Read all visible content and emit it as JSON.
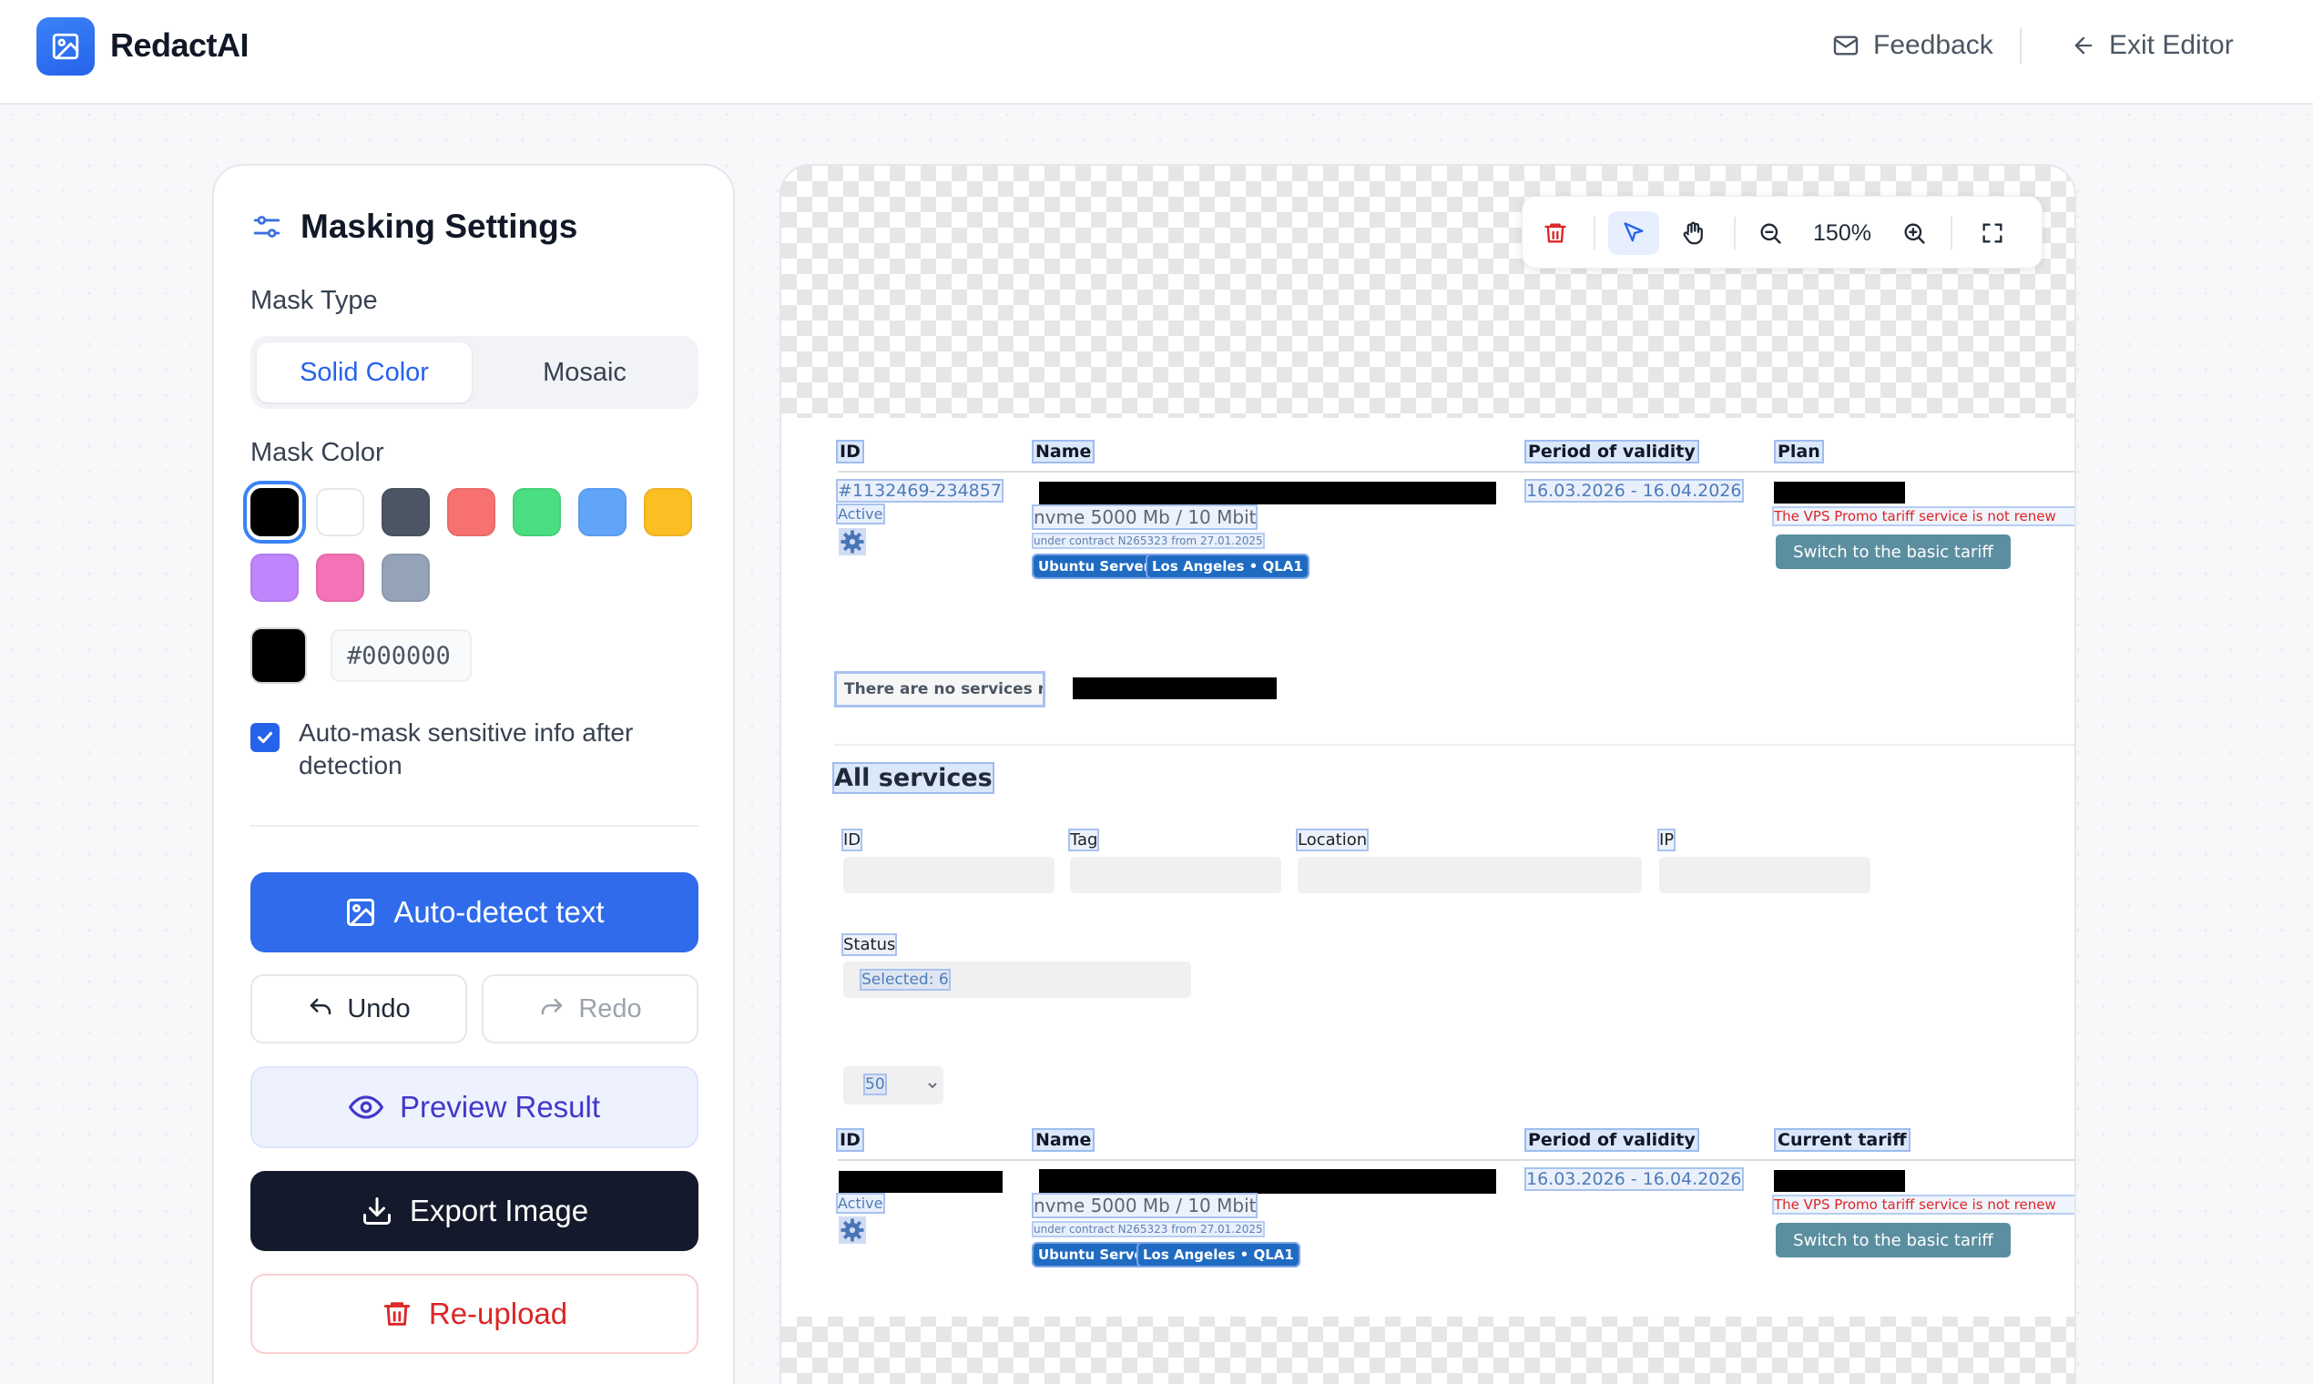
{
  "app": {
    "name": "RedactAI"
  },
  "header": {
    "feedback_label": "Feedback",
    "exit_label": "Exit Editor"
  },
  "panel": {
    "title": "Masking Settings",
    "mask_type_label": "Mask Type",
    "mask_types": [
      {
        "label": "Solid Color",
        "active": true
      },
      {
        "label": "Mosaic",
        "active": false
      }
    ],
    "mask_color_label": "Mask Color",
    "swatches": [
      "#000000",
      "#ffffff",
      "#4b5563",
      "#f87171",
      "#4ade80",
      "#60a5fa",
      "#fbbf24",
      "#c084fc",
      "#f472b6",
      "#94a3b8"
    ],
    "selected_color": "#000000",
    "hex_value": "#000000",
    "auto_mask_checked": true,
    "auto_mask_label": "Auto-mask sensitive info after detection",
    "auto_detect_label": "Auto-detect text",
    "undo_label": "Undo",
    "redo_label": "Redo",
    "preview_label": "Preview Result",
    "export_label": "Export Image",
    "reupload_label": "Re-upload"
  },
  "toolbar": {
    "zoom": "150%",
    "active_tool": "select"
  },
  "document": {
    "table1": {
      "headers": {
        "id": "ID",
        "name": "Name",
        "period": "Period of validity",
        "plan": "Plan"
      },
      "row": {
        "id": "#1132469-234857",
        "status": "Active",
        "name_line": "nvme 5000 Mb / 10 Mbit",
        "contract": "under contract N265323 from 27.01.2025",
        "tag_os": "Ubuntu Server",
        "tag_location": "Los Angeles • QLA1",
        "period": "16.03.2026 - 16.04.2026",
        "warning": "The VPS Promo tariff service is not renew",
        "switch_label": "Switch to the basic tariff"
      }
    },
    "notice": "There are no services requirin",
    "all_services_title": "All services",
    "filters": {
      "id_label": "ID",
      "tag_label": "Tag",
      "location_label": "Location",
      "ip_label": "IP",
      "status_label": "Status",
      "status_value": "Selected: 6",
      "page_size": "50"
    },
    "table2": {
      "headers": {
        "id": "ID",
        "name": "Name",
        "period": "Period of validity",
        "tariff": "Current tariff"
      },
      "row": {
        "status": "Active",
        "name_line": "nvme 5000 Mb / 10 Mbit",
        "contract": "under contract N265323 from 27.01.2025",
        "tag_os": "Ubuntu Server",
        "tag_location": "Los Angeles • QLA1",
        "period": "16.03.2026 - 16.04.2026",
        "warning": "The VPS Promo tariff service is not renew",
        "switch_label": "Switch to the basic tariff"
      }
    }
  },
  "colors": {
    "primary": "#2f6bea",
    "dark": "#141a2b",
    "danger": "#dc2626",
    "preview": "#4338ca"
  }
}
